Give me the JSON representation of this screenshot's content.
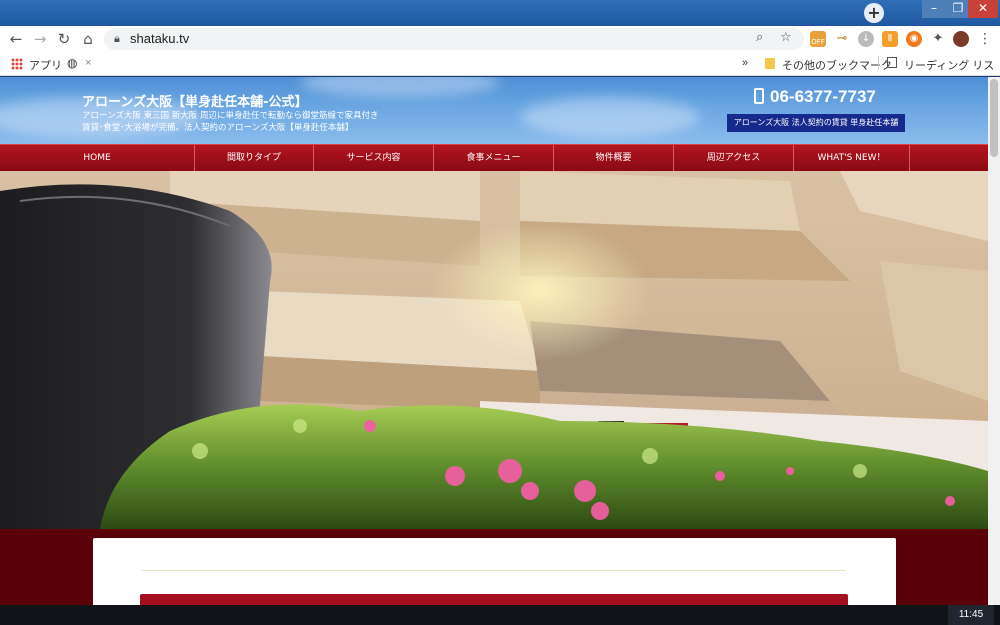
{
  "browser": {
    "url": "shataku.tv",
    "bookmarks": {
      "apps": "アプリ",
      "tab_close": "×",
      "overflow": "»",
      "other_bookmarks": "その他のブックマーク",
      "reading_list": "リーディング リスト"
    },
    "extension_badge": "OFF"
  },
  "site": {
    "title": "アローンズ大阪【単身赴任本舗-公式】",
    "description": "アローンズ大阪 東三国 新大阪 周辺に単身赴任で転勤なら御堂筋線で家具付き賃貸･食堂･大浴場が完備。法人契約のアローンズ大阪【単身赴任本舗】",
    "phone": "06-6377-7737",
    "badge": "アローンズ大阪 法人契約の賃貸 単身赴任本舗"
  },
  "nav": [
    {
      "label": "HOME"
    },
    {
      "label": "間取りタイプ"
    },
    {
      "label": "サービス内容"
    },
    {
      "label": "食事メニュー"
    },
    {
      "label": "物件概要"
    },
    {
      "label": "周辺アクセス"
    },
    {
      "label": "WHAT'S NEW！"
    }
  ],
  "taskbar": {
    "clock": "11:45"
  },
  "colors": {
    "nav_red": "#a3101b",
    "page_bg": "#5a0008",
    "badge_blue": "#152a8c"
  }
}
